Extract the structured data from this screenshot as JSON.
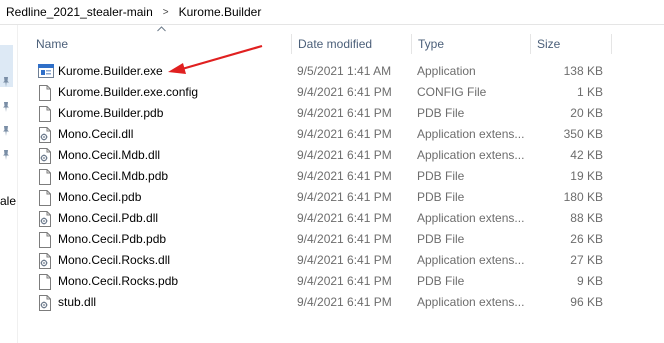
{
  "breadcrumb": {
    "path": [
      "Redline_2021_stealer-main",
      "Kurome.Builder"
    ],
    "separator": ">"
  },
  "left_pane": {
    "cut_label": "ale"
  },
  "columns": {
    "name": "Name",
    "date": "Date modified",
    "type": "Type",
    "size": "Size",
    "sort_indicator": "^"
  },
  "files": [
    {
      "name": "Kurome.Builder.exe",
      "date": "9/5/2021 1:41 AM",
      "type": "Application",
      "size": "138 KB",
      "icon": "exe-application-icon"
    },
    {
      "name": "Kurome.Builder.exe.config",
      "date": "9/4/2021 6:41 PM",
      "type": "CONFIG File",
      "size": "1 KB",
      "icon": "config-file-icon"
    },
    {
      "name": "Kurome.Builder.pdb",
      "date": "9/4/2021 6:41 PM",
      "type": "PDB File",
      "size": "20 KB",
      "icon": "pdb-file-icon"
    },
    {
      "name": "Mono.Cecil.dll",
      "date": "9/4/2021 6:41 PM",
      "type": "Application extens...",
      "size": "350 KB",
      "icon": "dll-file-icon"
    },
    {
      "name": "Mono.Cecil.Mdb.dll",
      "date": "9/4/2021 6:41 PM",
      "type": "Application extens...",
      "size": "42 KB",
      "icon": "dll-file-icon"
    },
    {
      "name": "Mono.Cecil.Mdb.pdb",
      "date": "9/4/2021 6:41 PM",
      "type": "PDB File",
      "size": "19 KB",
      "icon": "pdb-file-icon"
    },
    {
      "name": "Mono.Cecil.pdb",
      "date": "9/4/2021 6:41 PM",
      "type": "PDB File",
      "size": "180 KB",
      "icon": "pdb-file-icon"
    },
    {
      "name": "Mono.Cecil.Pdb.dll",
      "date": "9/4/2021 6:41 PM",
      "type": "Application extens...",
      "size": "88 KB",
      "icon": "dll-file-icon"
    },
    {
      "name": "Mono.Cecil.Pdb.pdb",
      "date": "9/4/2021 6:41 PM",
      "type": "PDB File",
      "size": "26 KB",
      "icon": "pdb-file-icon"
    },
    {
      "name": "Mono.Cecil.Rocks.dll",
      "date": "9/4/2021 6:41 PM",
      "type": "Application extens...",
      "size": "27 KB",
      "icon": "dll-file-icon"
    },
    {
      "name": "Mono.Cecil.Rocks.pdb",
      "date": "9/4/2021 6:41 PM",
      "type": "PDB File",
      "size": "9 KB",
      "icon": "pdb-file-icon"
    },
    {
      "name": "stub.dll",
      "date": "9/4/2021 6:41 PM",
      "type": "Application extens...",
      "size": "96 KB",
      "icon": "dll-file-icon"
    }
  ],
  "colors": {
    "header_text": "#4c607a",
    "muted_text": "#6d6d6d",
    "annotation_arrow": "#e02020",
    "nav_highlight": "#dde9f5"
  }
}
